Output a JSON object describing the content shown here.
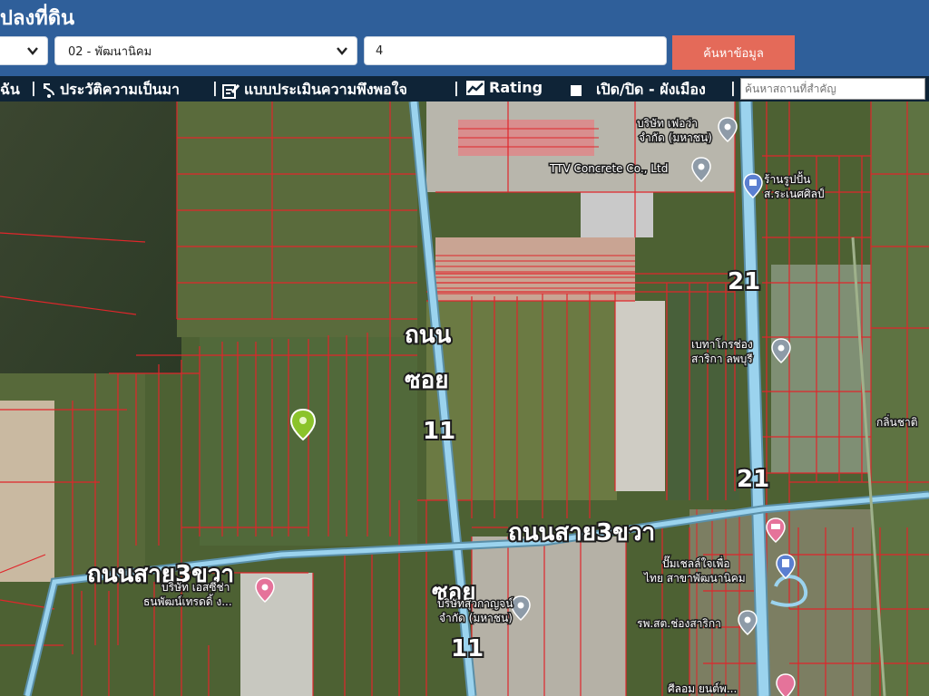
{
  "header": {
    "title": "ปลงที่ดิน",
    "select_1_value": "",
    "select_2_value": "02 - พัฒนานิคม",
    "parcel_value": "4",
    "search_button": "ค้นหาข้อมูล"
  },
  "toolbar": {
    "item_0": "ฉัน",
    "sep": "|",
    "history": "ประวัติความเป็นมา",
    "survey": "แบบประเมินความพึงพอใจ",
    "rating": "Rating",
    "toggle": "เปิด/ปิด - ผังเมือง",
    "place_placeholder": "ค้นหาสถานที่สำคัญ"
  },
  "map": {
    "road_labels": {
      "soi11_a1": "ถนน",
      "soi11_a2": "ซอย",
      "soi11_a3": "11",
      "road3_right": "ถนนสาย3ขวา",
      "road3_left": "ถนนสาย3ขวา",
      "soi11_b1": "ซอย",
      "soi11_b2": "11",
      "route21_a": "21",
      "route21_b": "21"
    },
    "places": {
      "p1_l1": "บริษัท เฟอว่า",
      "p1_l2": "จำกัด (มหาชน)",
      "p2": "TTV Concrete Co., Ltd",
      "p3_l1": "ร้านรูปปั้น",
      "p3_l2": "ส.ระเนศศิลป์",
      "p4_l1": "เบทาโกรช่อง",
      "p4_l2": "สาริกา ลพบุรี",
      "p5": "กลิ่นชาติ",
      "p6_l1": "ปั๊มเชลล์ใจเพื่อ",
      "p6_l2": "ไทย สาขาพัฒนานิคม",
      "p7_l1": "บริษัท เอสซีช่า",
      "p7_l2": "ธนพัฒน์เทรดดิ้ ง...",
      "p8_l1": "บริษัทสุวกาญจน์",
      "p8_l2": "จำกัด (มหาชน)",
      "p9": "รพ.สต.ช่องสาริกา",
      "p10": "ศีลอม ยนต์พ..."
    }
  },
  "colors": {
    "header": "#2f5f9a",
    "toolbar": "#0f2437",
    "search_button": "#e46a59",
    "parcel_line": "#e0262b",
    "road": "#9bd3ee",
    "marker_green": "#8bc32b"
  }
}
